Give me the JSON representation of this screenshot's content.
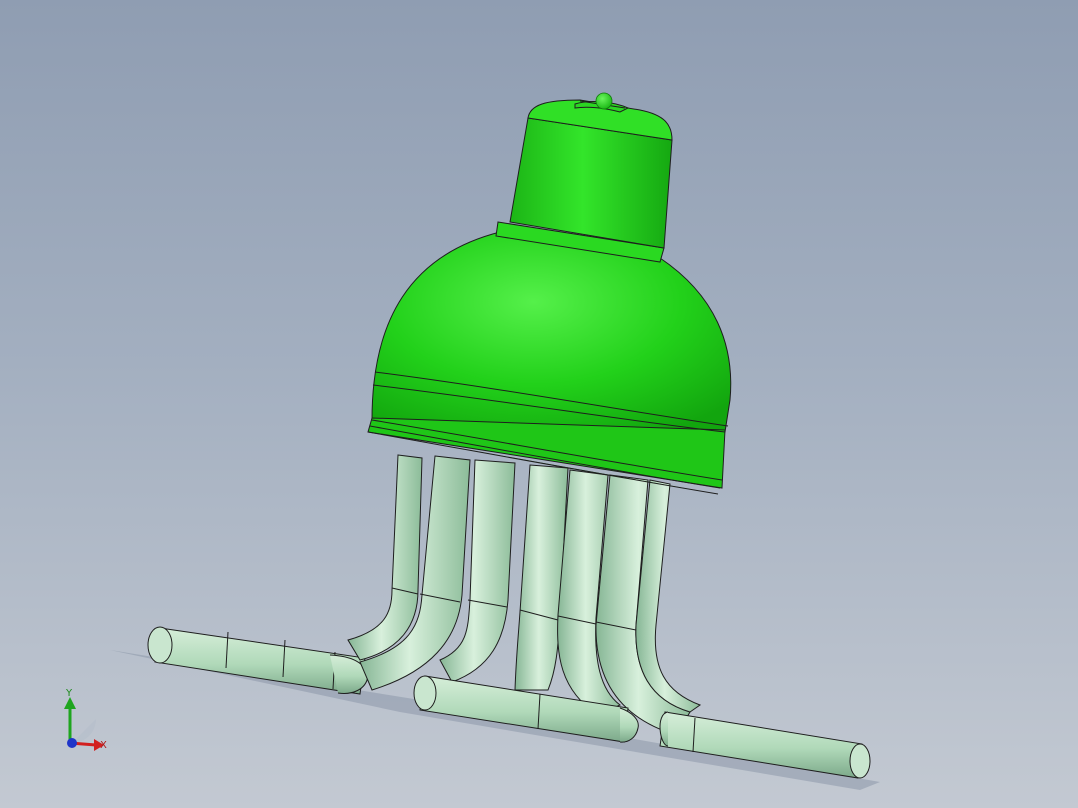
{
  "viewport": {
    "background_top": "#8f9db2",
    "background_bottom": "#c3c9d2"
  },
  "model": {
    "body_color": "#22d11a",
    "body_shade": "#13a10f",
    "tube_color": "#b2dcbc",
    "tube_shade": "#7fae8c",
    "edge_color": "#1e1e1e"
  },
  "triad": {
    "x_label": "X",
    "y_label": "Y",
    "x_color": "#d21f1f",
    "y_color": "#1ea51e",
    "z_color": "#1f35c9"
  }
}
